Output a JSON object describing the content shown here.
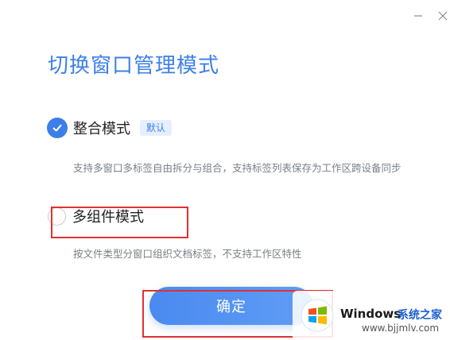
{
  "dialog": {
    "title": "切换窗口管理模式",
    "window_controls": {
      "minimize_icon": "minimize-icon",
      "close_icon": "close-icon"
    }
  },
  "options": [
    {
      "label": "整合模式",
      "badge": "默认",
      "description": "支持多窗口多标签自由拆分与组合，支持标签列表保存为工作区跨设备同步",
      "selected": true
    },
    {
      "label": "多组件模式",
      "description": "按文件类型分窗口组织文档标签，不支持工作区特性",
      "selected": false
    }
  ],
  "confirm_button": {
    "label": "确定"
  },
  "watermark": {
    "brand": "Windows",
    "site_name": "系统之家",
    "url": "www.bjjmlv.com"
  },
  "colors": {
    "accent": "#3d7fe8",
    "annotation_red": "#e03131"
  }
}
